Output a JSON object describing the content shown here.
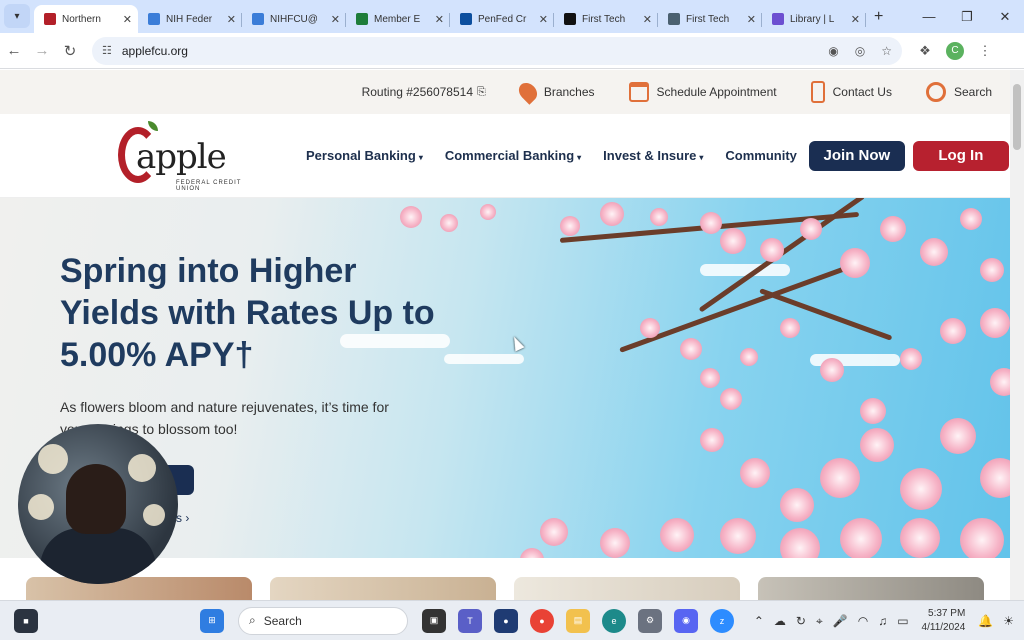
{
  "browser": {
    "tabs": [
      {
        "title": "Northern",
        "color": "#b32029",
        "active": true
      },
      {
        "title": "NIH Feder",
        "color": "#3b7dd8"
      },
      {
        "title": "NIHFCU@",
        "color": "#3b7dd8"
      },
      {
        "title": "Member E",
        "color": "#1e7d3a"
      },
      {
        "title": "PenFed Cr",
        "color": "#0d4f9e"
      },
      {
        "title": "First Tech",
        "color": "#111111"
      },
      {
        "title": "First Tech",
        "color": "#4a6070"
      },
      {
        "title": "Library | L",
        "color": "#6c4fd1"
      }
    ],
    "url": "applefcu.org"
  },
  "utility_bar": {
    "routing": "Routing #256078514",
    "branches": "Branches",
    "schedule": "Schedule Appointment",
    "contact": "Contact Us",
    "search": "Search"
  },
  "logo": {
    "word": "apple",
    "sub": "FEDERAL CREDIT UNION"
  },
  "nav": {
    "personal": "Personal Banking",
    "commercial": "Commercial Banking",
    "invest": "Invest & Insure",
    "community": "Community",
    "join": "Join Now",
    "login": "Log In"
  },
  "hero": {
    "headline": "Spring into Higher Yields with Rates Up to 5.00% APY†",
    "body": "As flowers bloom and nature rejuvenates, it’s time for your savings to blossom too!",
    "link_fragment": "s ›"
  },
  "taskbar": {
    "search_placeholder": "Search",
    "time": "5:37 PM",
    "date": "4/11/2024"
  },
  "colors": {
    "brand_red": "#b7212f",
    "brand_navy": "#1a2e52"
  }
}
